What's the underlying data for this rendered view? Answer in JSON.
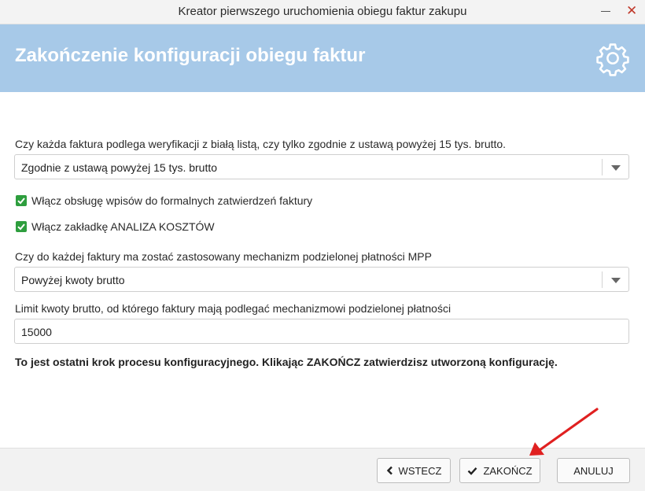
{
  "window": {
    "title": "Kreator pierwszego uruchomienia obiegu faktur zakupu",
    "minimize_icon": "minimize-icon",
    "close_icon": "close-icon"
  },
  "header": {
    "heading": "Zakończenie konfiguracji obiegu faktur",
    "icon": "gear-icon"
  },
  "form": {
    "whitelist_question": "Czy każda faktura podlega weryfikacji z białą listą, czy tylko zgodnie z ustawą powyżej 15 tys. brutto.",
    "whitelist_value": "Zgodnie z ustawą powyżej 15 tys. brutto",
    "checkbox_formal_approvals": {
      "label": "Włącz obsługę wpisów do formalnych zatwierdzeń faktury",
      "checked": true
    },
    "checkbox_cost_analysis": {
      "label": "Włącz zakładkę ANALIZA KOSZTÓW",
      "checked": true
    },
    "mpp_question": "Czy do każdej faktury ma zostać zastosowany mechanizm podzielonej płatności MPP",
    "mpp_value": "Powyżej kwoty brutto",
    "limit_label": "Limit kwoty brutto, od którego faktury mają podlegać mechanizmowi podzielonej płatności",
    "limit_value": "15000",
    "final_note": "To jest ostatni krok procesu konfiguracyjnego. Klikając ZAKOŃCZ zatwierdzisz utworzoną konfigurację."
  },
  "footer": {
    "back_label": "WSTECZ",
    "finish_label": "ZAKOŃCZ",
    "cancel_label": "ANULUJ"
  },
  "colors": {
    "header_bg": "#a7c9e8",
    "checkbox_green": "#2e9e3e",
    "annotation_arrow": "#e02020"
  }
}
